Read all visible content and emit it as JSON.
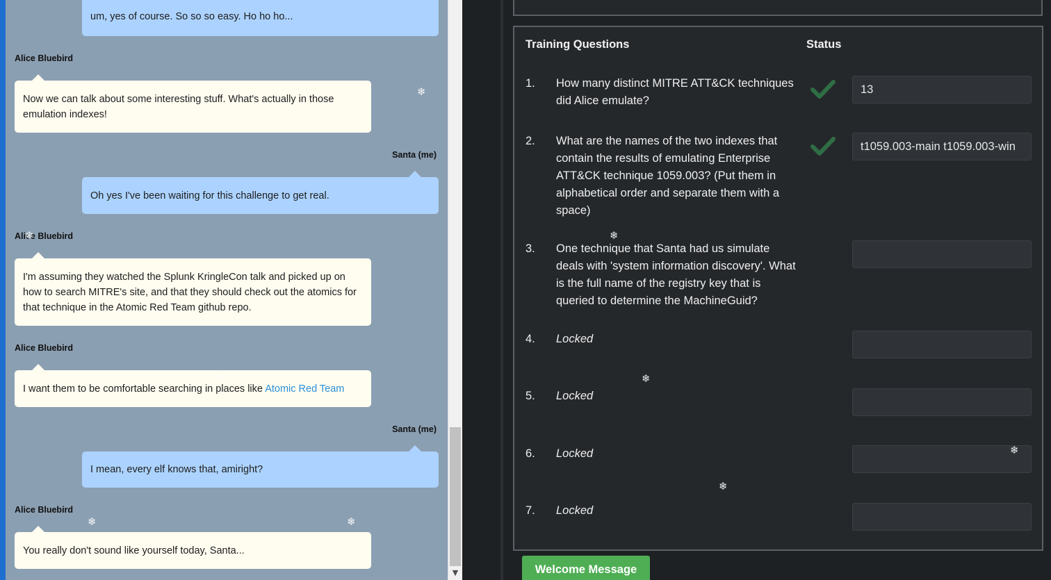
{
  "chat": {
    "messages": [
      {
        "speaker": "",
        "text": "um, yes of course. So so so easy. Ho ho ho..."
      },
      {
        "speaker": "Alice Bluebird",
        "text": "Now we can talk about some interesting stuff. What's actually in those emulation indexes!"
      },
      {
        "speaker": "Santa (me)",
        "text": "Oh yes I've been waiting for this challenge to get real."
      },
      {
        "speaker": "Alice Bluebird",
        "text": "I'm assuming they watched the Splunk KringleCon talk and picked up on how to search MITRE's site, and that they should check out the atomics for that technique in the Atomic Red Team github repo."
      },
      {
        "speaker": "Alice Bluebird",
        "text": "I want them to be comfortable searching in places like ",
        "link": "Atomic Red Team"
      },
      {
        "speaker": "Santa (me)",
        "text": "I mean, every elf knows that, amiright?"
      },
      {
        "speaker": "Alice Bluebird",
        "text": "You really don't sound like yourself today, Santa..."
      }
    ]
  },
  "training": {
    "header_questions": "Training Questions",
    "header_status": "Status",
    "questions": [
      {
        "num": "1.",
        "text": "How many distinct MITRE ATT&CK techniques did Alice emulate?",
        "answer": "13",
        "status": "check-icon"
      },
      {
        "num": "2.",
        "text": "What are the names of the two indexes that contain the results of emulating Enterprise ATT&CK technique 1059.003? (Put them in alphabetical order and separate them with a space)",
        "answer": "t1059.003-main t1059.003-win",
        "status": "check-icon"
      },
      {
        "num": "3.",
        "text": "One technique that Santa had us simulate deals with 'system information discovery'. What is the full name of the registry key that is queried to determine the MachineGuid?",
        "answer": "",
        "status": ""
      },
      {
        "num": "4.",
        "text": "Locked",
        "answer": "",
        "status": ""
      },
      {
        "num": "5.",
        "text": "Locked",
        "answer": "",
        "status": ""
      },
      {
        "num": "6.",
        "text": "Locked",
        "answer": "",
        "status": ""
      },
      {
        "num": "7.",
        "text": "Locked",
        "answer": "",
        "status": ""
      }
    ],
    "welcome_button": "Welcome Message"
  },
  "decor": {
    "snowflake_glyph": "❄",
    "scroll_arrow": "▼"
  },
  "colors": {
    "accent_green": "#4fae54",
    "check_green": "#2f6e45",
    "santa_bubble": "#acd3ff",
    "alice_bubble": "#fffcf0",
    "chat_bg": "#8b9fb2"
  }
}
